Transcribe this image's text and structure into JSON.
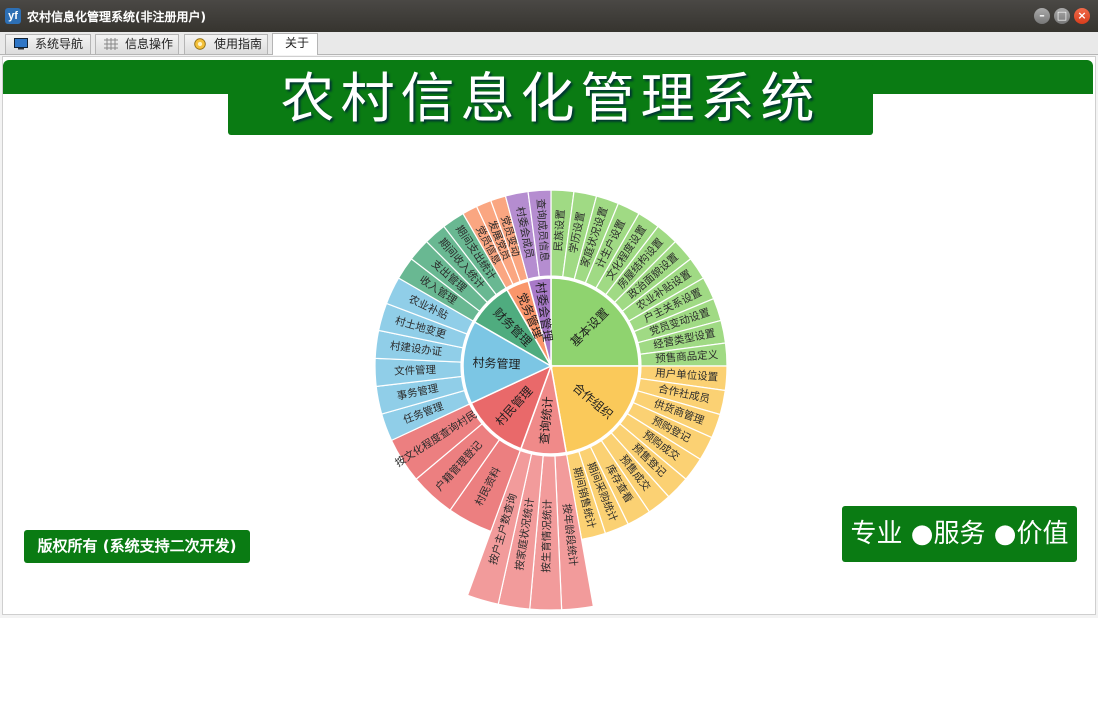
{
  "window": {
    "title": "农村信息化管理系统(非注册用户)",
    "app_icon": "yf"
  },
  "tabs": [
    {
      "label": "系统导航",
      "icon": "monitor-icon"
    },
    {
      "label": "信息操作",
      "icon": "grid-icon"
    },
    {
      "label": "使用指南",
      "icon": "guide-icon"
    },
    {
      "label": "关于",
      "icon": ""
    }
  ],
  "header": {
    "title": "农村信息化管理系统"
  },
  "footer": {
    "copyright": "版权所有 (系统支持二次开发)",
    "slogan": "专业 ●服务 ●价值"
  },
  "colors": {
    "brand_green": "#0a7b13"
  },
  "sunburst": {
    "center": [
      551,
      366
    ],
    "inner_r": 88,
    "outer_r": 176,
    "categories": [
      {
        "name": "基本设置",
        "color": "#8fd36f",
        "start": 0,
        "end": 90,
        "items": [
          "民族设置",
          "学历设置",
          "家庭状况设置",
          "计生户设置",
          "文化程度设置",
          "房屋结构设置",
          "政治面貌设置",
          "农业补贴设置",
          "户主关系设置",
          "党员变动设置",
          "经营类型设置",
          "预售商品定义"
        ]
      },
      {
        "name": "合作组织",
        "color": "#fac95a",
        "start": 90,
        "end": 170,
        "items": [
          "用户单位设置",
          "合作社成员",
          "供货商管理",
          "预购登记",
          "预购成交",
          "预售登记",
          "预售成交",
          "库存查看",
          "期间采购统计",
          "期间销售统计"
        ]
      },
      {
        "name": "查询统计",
        "color": "#f08a89",
        "start": 170,
        "end": 200,
        "items": [
          "按年龄段统计",
          "按生育情况统计",
          "按家庭状况统计",
          "按户主户数查询"
        ],
        "extra_r": 244
      },
      {
        "name": "村民管理",
        "color": "#e9696a",
        "start": 200,
        "end": 245,
        "items": [
          "村民资料",
          "户籍管理登记",
          "按文化程度查询村民"
        ]
      },
      {
        "name": "村务管理",
        "color": "#7cc6e4",
        "start": 245,
        "end": 300,
        "items": [
          "任务管理",
          "事务管理",
          "文件管理",
          "村建设办证",
          "村土地变更",
          "农业补贴"
        ]
      },
      {
        "name": "财务管理",
        "color": "#4fac7f",
        "start": 300,
        "end": 330,
        "items": [
          "收入管理",
          "支出管理",
          "期间收入统计",
          "期间支出统计"
        ]
      },
      {
        "name": "党务管理",
        "color": "#f9966b",
        "start": 330,
        "end": 345,
        "items": [
          "党员信息",
          "发展党员",
          "党员变动"
        ]
      },
      {
        "name": "村委会管理",
        "color": "#a879c8",
        "start": 345,
        "end": 360,
        "items": [
          "村委会成员",
          "查询成员信息"
        ]
      }
    ]
  }
}
